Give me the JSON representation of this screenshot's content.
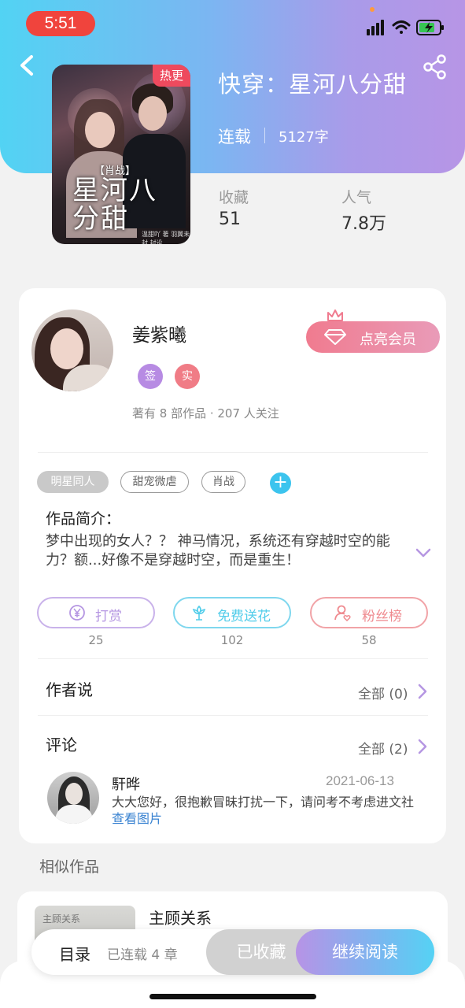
{
  "status_bar": {
    "time": "5:51"
  },
  "book": {
    "cover_tag": "热更",
    "cover_label": "【肖战】",
    "cover_title": "星河八分甜",
    "cover_credit": "温甜吖 著 羽翼未封 封设",
    "title": "快穿：星河八分甜",
    "status": "连载",
    "word_count": "5127字",
    "collect_label": "收藏",
    "collect_value": "51",
    "popularity_label": "人气",
    "popularity_value": "7.8万"
  },
  "author": {
    "name": "姜紫曦",
    "badge_sign": "签",
    "badge_real": "实",
    "meta": "著有 8 部作品 · 207 人关注",
    "vip_label": "点亮会员"
  },
  "tags": [
    "明星同人",
    "甜宠微虐",
    "肖战"
  ],
  "intro": {
    "title": "作品简介：",
    "text": "梦中出现的女人？？ 神马情况，系统还有穿越时空的能力？额...好像不是穿越时空，而是重生！"
  },
  "actions": [
    {
      "label": "打赏",
      "count": "25",
      "color": "#b596e2",
      "icon": "yen-coin-icon"
    },
    {
      "label": "免费送花",
      "count": "102",
      "color": "#52cdea",
      "icon": "flower-icon"
    },
    {
      "label": "粉丝榜",
      "count": "58",
      "color": "#ef8a8f",
      "icon": "fan-rank-icon"
    }
  ],
  "author_says": {
    "title": "作者说",
    "all_label": "全部 (0)"
  },
  "comments": {
    "title": "评论",
    "all_label": "全部 (2)",
    "items": [
      {
        "name": "馯晔",
        "date": "2021-06-13",
        "text": "大大您好，很抱歉冒昧打扰一下，请问考不考虑进文社",
        "link": "查看图片"
      }
    ]
  },
  "similar": {
    "title": "相似作品",
    "items": [
      {
        "title": "主顾关系",
        "cover_text": "主顾关系"
      }
    ]
  },
  "bottom_bar": {
    "toc_label": "目录",
    "toc_progress": "已连载 4 章",
    "collected_label": "已收藏",
    "read_label": "继续阅读"
  },
  "colors": {
    "header_gradient": [
      "#52d3f3",
      "#b795e6"
    ],
    "hot_tag": "#ee4a5e",
    "vip": "#f07b8f",
    "link": "#3a83d1"
  }
}
